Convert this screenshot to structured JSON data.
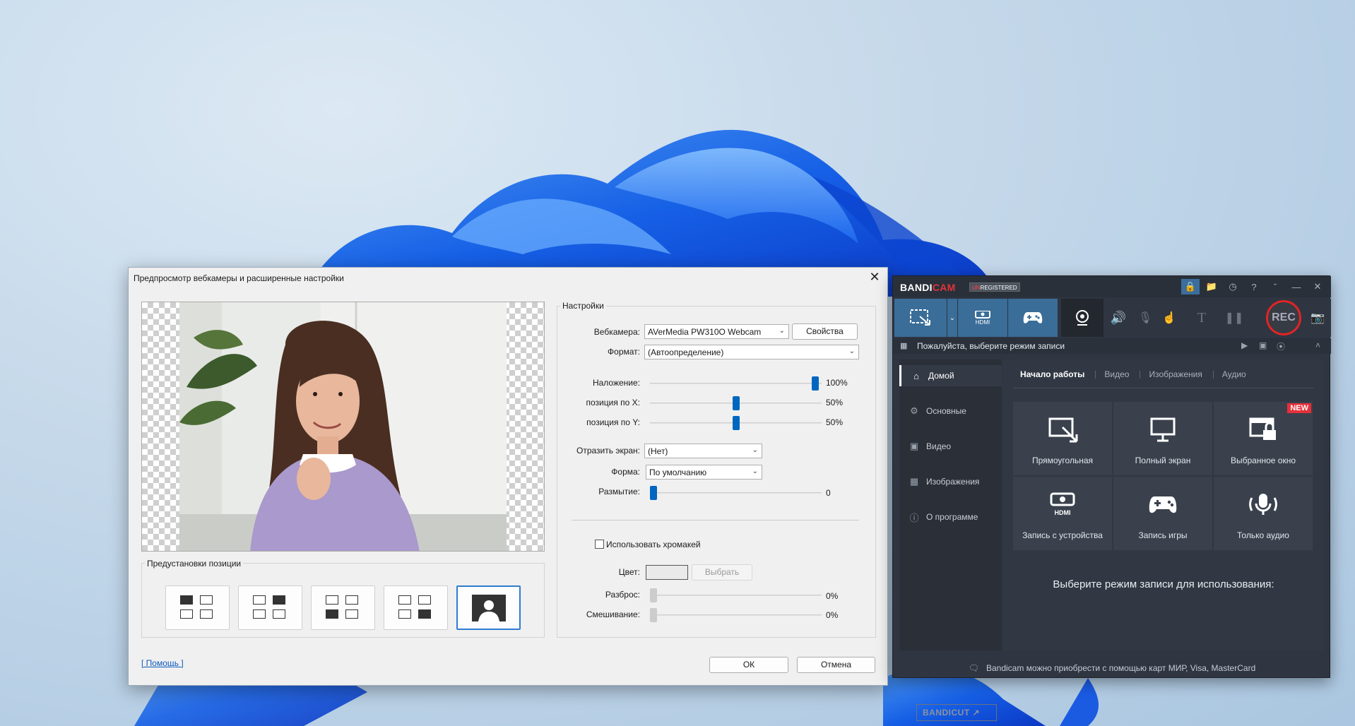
{
  "dialog": {
    "title": "Предпросмотр вебкамеры и расширенные настройки",
    "presets_label": "Предустановки позиции",
    "settings_label": "Настройки",
    "webcam_label": "Вебкамера:",
    "webcam_value": "AVerMedia PW310O Webcam",
    "properties_button": "Свойства",
    "format_label": "Формат:",
    "format_value": "(Автоопределение)",
    "overlay_label": "Наложение:",
    "overlay_value": "100%",
    "posx_label": "позиция по X:",
    "posx_value": "50%",
    "posy_label": "позиция по Y:",
    "posy_value": "50%",
    "mirror_label": "Отразить экран:",
    "mirror_value": "(Нет)",
    "shape_label": "Форма:",
    "shape_value": "По умолчанию",
    "blur_label": "Размытие:",
    "blur_value": "0",
    "chroma_label": "Использовать хромакей",
    "color_label": "Цвет:",
    "choose_button": "Выбрать",
    "spread_label": "Разброс:",
    "spread_value": "0%",
    "mix_label": "Смешивание:",
    "mix_value": "0%",
    "help_link": "[ Помощь ]",
    "ok_button": "ОК",
    "cancel_button": "Отмена",
    "levels": {
      "overlay": 1.0,
      "posx": 0.5,
      "posy": 0.5,
      "blur": 0,
      "spread": 0,
      "mix": 0
    }
  },
  "bandicam": {
    "brand_a": "BANDI",
    "brand_b": "CAM",
    "unreg_a": "UN",
    "unreg_b": "REGISTERED",
    "mode_bar_text": "Пожалуйста, выберите режим записи",
    "rec_label": "REC",
    "hdmi_label": "HDMI",
    "sidebar": [
      {
        "label": "Домой",
        "icon": "home-icon"
      },
      {
        "label": "Основные",
        "icon": "gear-icon"
      },
      {
        "label": "Видео",
        "icon": "video-icon"
      },
      {
        "label": "Изображения",
        "icon": "image-icon"
      },
      {
        "label": "О программе",
        "icon": "info-icon"
      }
    ],
    "bandicut_a": "BANDI",
    "bandicut_b": "CUT",
    "tabs": [
      "Начало работы",
      "Видео",
      "Изображения",
      "Аудио"
    ],
    "tiles": [
      {
        "label": "Прямоугольная",
        "icon": "rectangle-area-icon"
      },
      {
        "label": "Полный экран",
        "icon": "fullscreen-icon"
      },
      {
        "label": "Выбранное окно",
        "icon": "locked-window-icon",
        "badge": "NEW"
      },
      {
        "label": "Запись с устройства",
        "icon": "hdmi-device-icon"
      },
      {
        "label": "Запись игры",
        "icon": "gamepad-icon"
      },
      {
        "label": "Только аудио",
        "icon": "microphone-icon"
      }
    ],
    "choose_mode_text": "Выберите режим записи для использования:",
    "footer_text": "Bandicam можно приобрести с помощью карт МИР, Visa, MasterCard",
    "colors": {
      "accent": "#3a6d98",
      "rec_ring": "#e02424",
      "new_badge": "#e6303a"
    }
  }
}
